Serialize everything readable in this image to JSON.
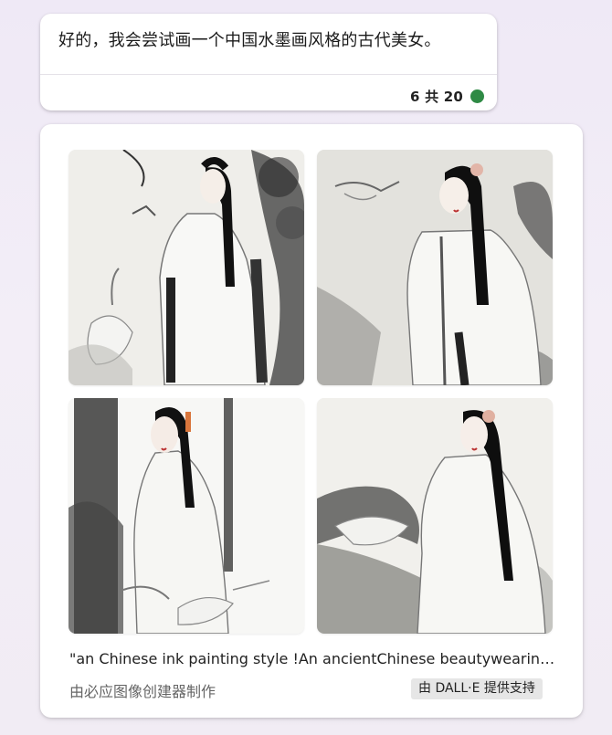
{
  "message": {
    "text": "好的，我会尝试画一个中国水墨画风格的古代美女。",
    "turn_counter": "6 共 20",
    "status_color": "#2f8a45"
  },
  "image_creator": {
    "images": [
      {
        "alt": "ink painting image 1"
      },
      {
        "alt": "ink painting image 2"
      },
      {
        "alt": "ink painting image 3"
      },
      {
        "alt": "ink painting image 4"
      }
    ],
    "prompt_caption": "\"an Chinese ink painting style !An ancientChinese beautywearin… \"",
    "made_with": "由必应图像创建器制作",
    "powered_by": "由 DALL·E 提供支持"
  }
}
